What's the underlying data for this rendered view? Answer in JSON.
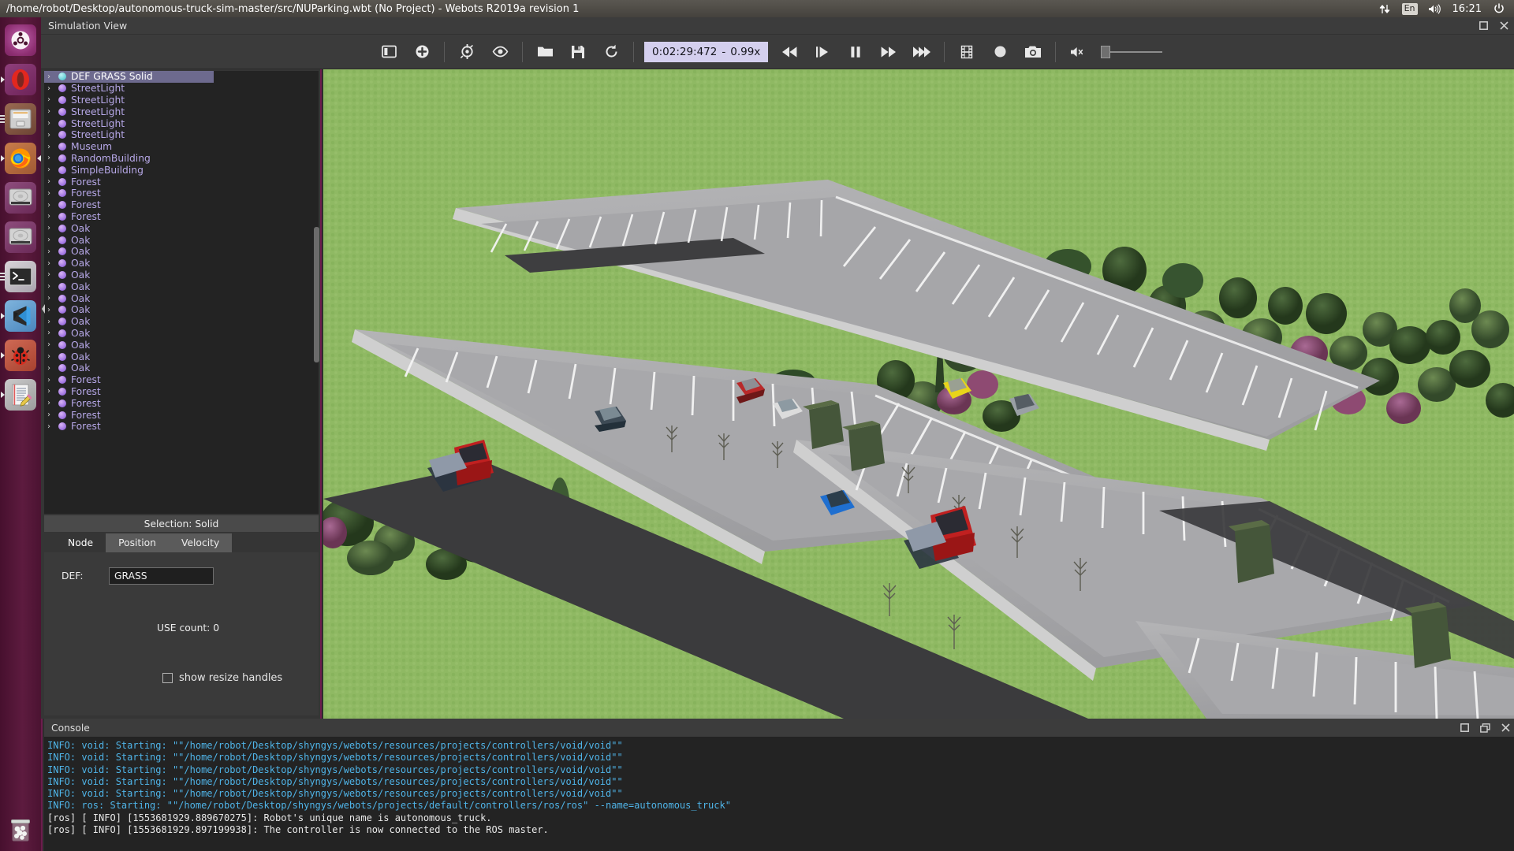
{
  "top_panel": {
    "window_title": "/home/robot/Desktop/autonomous-truck-sim-master/src/NUParking.wbt (No Project) - Webots R2019a revision 1",
    "tray": {
      "network_icon": "network-updown-icon",
      "keyboard_layout": "En",
      "volume_icon": "volume-icon",
      "clock": "16:21",
      "power_icon": "power-icon"
    }
  },
  "launcher": {
    "items": [
      {
        "name": "ubuntu-dash",
        "label": "Ubuntu Dash"
      },
      {
        "name": "opera-browser",
        "label": "Opera"
      },
      {
        "name": "files-manager",
        "label": "Files"
      },
      {
        "name": "firefox-browser",
        "label": "Firefox"
      },
      {
        "name": "disk-utility",
        "label": "Disk"
      },
      {
        "name": "disk-drive",
        "label": "Drive"
      },
      {
        "name": "terminal",
        "label": "Terminal"
      },
      {
        "name": "vscode",
        "label": "Visual Studio Code"
      },
      {
        "name": "debug-ladybug",
        "label": "Debug"
      },
      {
        "name": "text-editor",
        "label": "Text Editor"
      },
      {
        "name": "trash",
        "label": "Trash"
      }
    ]
  },
  "sim_view": {
    "title": "Simulation View",
    "maximize_label": "☐",
    "close_label": "✕"
  },
  "toolbar": {
    "buttons": [
      {
        "name": "toggle-panel-icon",
        "tooltip": "Toggle side panel"
      },
      {
        "name": "add-node-icon",
        "tooltip": "Add new node"
      },
      {
        "name": "restore-viewpoint-icon",
        "tooltip": "Restore viewpoint"
      },
      {
        "name": "follow-object-icon",
        "tooltip": "Follow object"
      },
      {
        "name": "open-world-icon",
        "tooltip": "Open world"
      },
      {
        "name": "save-world-icon",
        "tooltip": "Save world"
      },
      {
        "name": "reload-world-icon",
        "tooltip": "Reload world"
      }
    ],
    "time_display": {
      "time": "0:02:29:472",
      "separator": "-",
      "speed": "0.99x"
    },
    "playback": [
      {
        "name": "reset-simulation-icon",
        "tooltip": "Reset"
      },
      {
        "name": "step-simulation-icon",
        "tooltip": "Step"
      },
      {
        "name": "pause-simulation-icon",
        "tooltip": "Pause"
      },
      {
        "name": "run-simulation-icon",
        "tooltip": "Run"
      },
      {
        "name": "fast-simulation-icon",
        "tooltip": "Fast"
      }
    ],
    "media": [
      {
        "name": "make-movie-icon",
        "tooltip": "Make movie"
      },
      {
        "name": "record-icon",
        "tooltip": "Record"
      },
      {
        "name": "screenshot-icon",
        "tooltip": "Take screenshot"
      }
    ],
    "sound": {
      "mute_icon": "volume-mute-icon",
      "slider_value": 0
    }
  },
  "scene_tree": {
    "nodes": [
      {
        "label": "DEF GRASS Solid",
        "selected": true,
        "color": "cyan"
      },
      {
        "label": "StreetLight",
        "selected": false,
        "color": "purple"
      },
      {
        "label": "StreetLight",
        "selected": false,
        "color": "purple"
      },
      {
        "label": "StreetLight",
        "selected": false,
        "color": "purple"
      },
      {
        "label": "StreetLight",
        "selected": false,
        "color": "purple"
      },
      {
        "label": "StreetLight",
        "selected": false,
        "color": "purple"
      },
      {
        "label": "Museum",
        "selected": false,
        "color": "purple"
      },
      {
        "label": "RandomBuilding",
        "selected": false,
        "color": "purple"
      },
      {
        "label": "SimpleBuilding",
        "selected": false,
        "color": "purple"
      },
      {
        "label": "Forest",
        "selected": false,
        "color": "purple"
      },
      {
        "label": "Forest",
        "selected": false,
        "color": "purple"
      },
      {
        "label": "Forest",
        "selected": false,
        "color": "purple"
      },
      {
        "label": "Forest",
        "selected": false,
        "color": "purple"
      },
      {
        "label": "Oak",
        "selected": false,
        "color": "purple"
      },
      {
        "label": "Oak",
        "selected": false,
        "color": "purple"
      },
      {
        "label": "Oak",
        "selected": false,
        "color": "purple"
      },
      {
        "label": "Oak",
        "selected": false,
        "color": "purple"
      },
      {
        "label": "Oak",
        "selected": false,
        "color": "purple"
      },
      {
        "label": "Oak",
        "selected": false,
        "color": "purple"
      },
      {
        "label": "Oak",
        "selected": false,
        "color": "purple"
      },
      {
        "label": "Oak",
        "selected": false,
        "color": "purple"
      },
      {
        "label": "Oak",
        "selected": false,
        "color": "purple"
      },
      {
        "label": "Oak",
        "selected": false,
        "color": "purple"
      },
      {
        "label": "Oak",
        "selected": false,
        "color": "purple"
      },
      {
        "label": "Oak",
        "selected": false,
        "color": "purple"
      },
      {
        "label": "Oak",
        "selected": false,
        "color": "purple"
      },
      {
        "label": "Forest",
        "selected": false,
        "color": "purple"
      },
      {
        "label": "Forest",
        "selected": false,
        "color": "purple"
      },
      {
        "label": "Forest",
        "selected": false,
        "color": "purple"
      },
      {
        "label": "Forest",
        "selected": false,
        "color": "purple"
      },
      {
        "label": "Forest",
        "selected": false,
        "color": "purple"
      }
    ],
    "expand_arrow": "›"
  },
  "node_panel": {
    "selection_label": "Selection: Solid",
    "tabs": [
      {
        "label": "Node",
        "active": true
      },
      {
        "label": "Position",
        "active": false
      },
      {
        "label": "Velocity",
        "active": false
      }
    ],
    "def_label": "DEF:",
    "def_value": "GRASS",
    "use_count": "USE count: 0",
    "resize_handles_label": "show resize handles",
    "resize_handles_checked": false
  },
  "console": {
    "title": "Console",
    "maximize_label": "☐",
    "float_label": "⧉",
    "close_label": "✕",
    "lines": [
      {
        "type": "info",
        "text": "INFO: void: Starting: \"\"/home/robot/Desktop/shyngys/webots/resources/projects/controllers/void/void\"\""
      },
      {
        "type": "info",
        "text": "INFO: void: Starting: \"\"/home/robot/Desktop/shyngys/webots/resources/projects/controllers/void/void\"\""
      },
      {
        "type": "info",
        "text": "INFO: void: Starting: \"\"/home/robot/Desktop/shyngys/webots/resources/projects/controllers/void/void\"\""
      },
      {
        "type": "info",
        "text": "INFO: void: Starting: \"\"/home/robot/Desktop/shyngys/webots/resources/projects/controllers/void/void\"\""
      },
      {
        "type": "info",
        "text": "INFO: void: Starting: \"\"/home/robot/Desktop/shyngys/webots/resources/projects/controllers/void/void\"\""
      },
      {
        "type": "info",
        "text": "INFO: ros: Starting: \"\"/home/robot/Desktop/shyngys/webots/projects/default/controllers/ros/ros\" --name=autonomous_truck\""
      },
      {
        "type": "ros",
        "text": "[ros] [ INFO] [1553681929.889670275]: Robot's unique name is autonomous_truck."
      },
      {
        "type": "ros",
        "text": "[ros] [ INFO] [1553681929.897199938]: The controller is now connected to the ROS master."
      }
    ]
  },
  "viewport": {
    "description": "3D parking lot simulation scene",
    "colors": {
      "grass": "#8fb963",
      "asphalt_dark": "#3a3a3c",
      "parking_surface": "#a9a9ab",
      "lot_edge": "#cfcfcf",
      "stripe": "#f2f2f2",
      "road": "#3c3c3e"
    },
    "vehicles": [
      {
        "name": "truck-cab-red-left",
        "color": "#c02020"
      },
      {
        "name": "truck-cab-red-right",
        "color": "#c02020"
      },
      {
        "name": "car-red",
        "color": "#b82a2a"
      },
      {
        "name": "car-dark-blue",
        "color": "#3d4a55"
      },
      {
        "name": "car-silver",
        "color": "#c8ccd0"
      },
      {
        "name": "car-yellow",
        "color": "#e8d41a"
      },
      {
        "name": "car-grey",
        "color": "#9aa0a6"
      },
      {
        "name": "car-blue",
        "color": "#1f6fd0"
      },
      {
        "name": "car-white",
        "color": "#dcdcdc"
      }
    ],
    "containers": [
      {
        "name": "container-green-a",
        "color": "#3d5230"
      },
      {
        "name": "container-green-b",
        "color": "#3d5230"
      },
      {
        "name": "container-green-c",
        "color": "#3d5230"
      },
      {
        "name": "container-green-d",
        "color": "#3d5230"
      }
    ]
  }
}
